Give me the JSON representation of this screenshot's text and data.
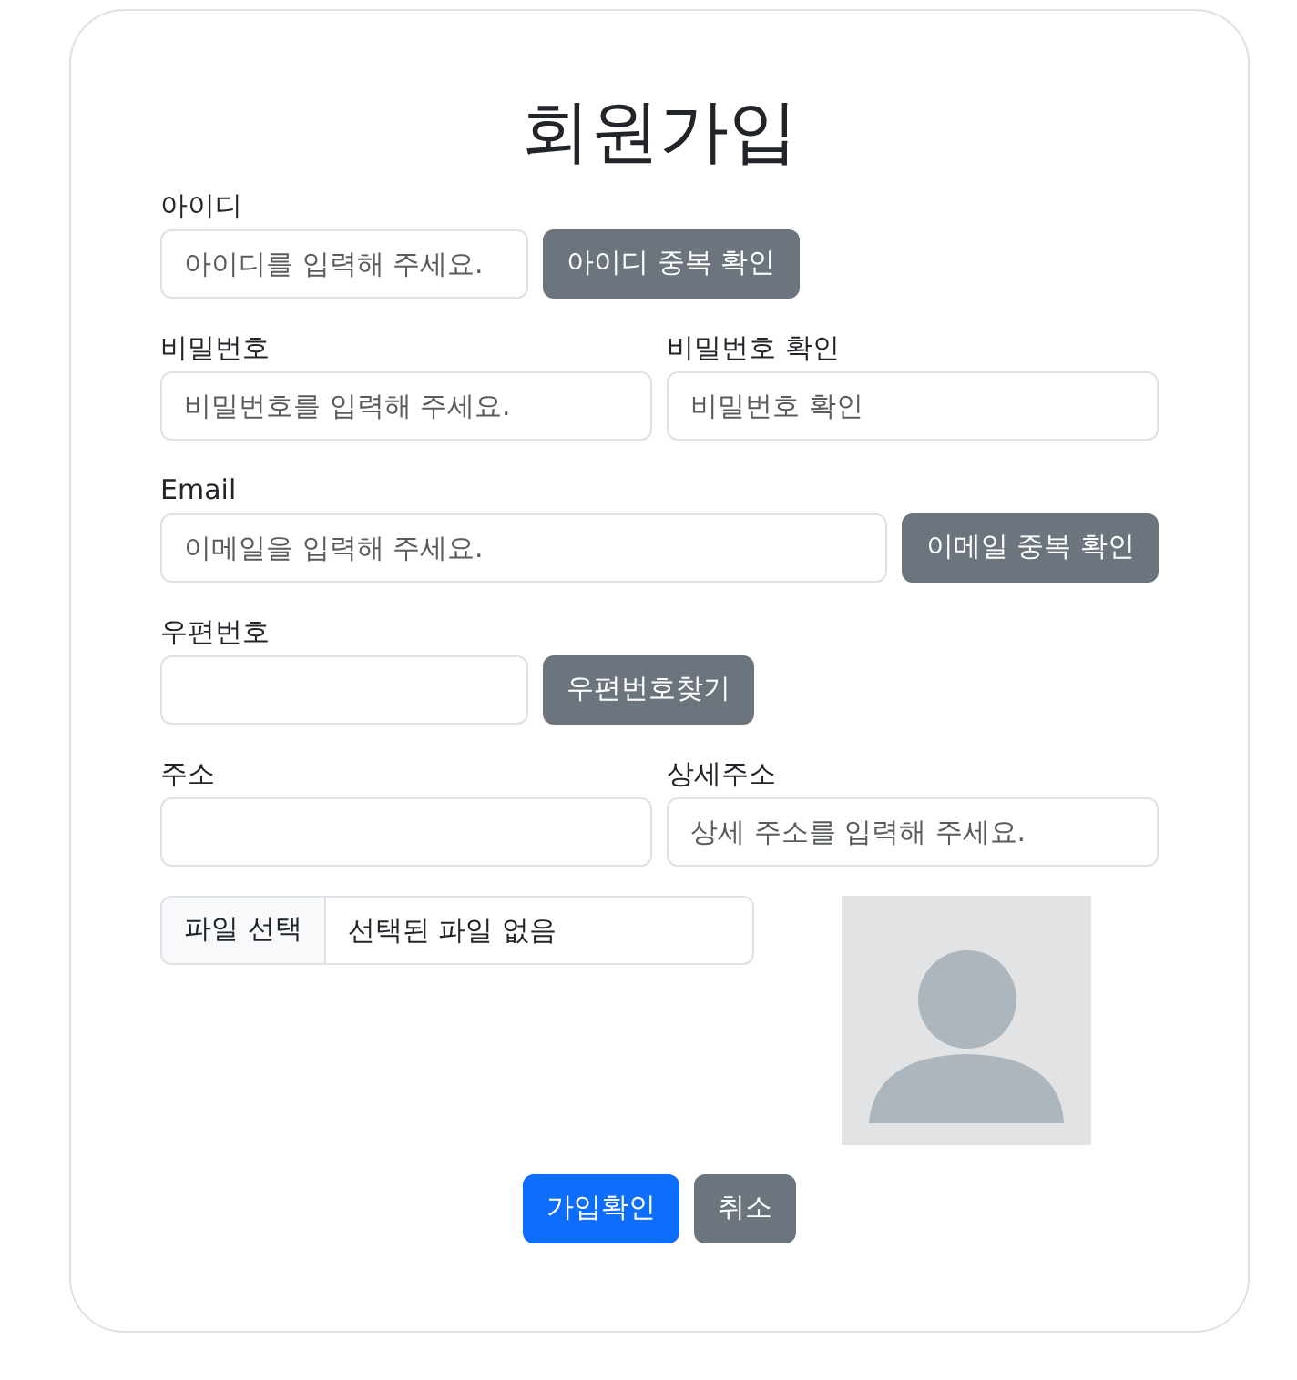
{
  "title": "회원가입",
  "rows": [
    {
      "kind": "short",
      "label": "아이디",
      "placeholder": "아이디를 입력해 주세요.",
      "button": "아이디 중복 확인"
    },
    {
      "kind": "pair",
      "fields": [
        {
          "label": "비밀번호",
          "placeholder": "비밀번호를 입력해 주세요."
        },
        {
          "label": "비밀번호 확인",
          "placeholder": "비밀번호 확인"
        }
      ]
    },
    {
      "kind": "wide",
      "label": "Email",
      "placeholder": "이메일을 입력해 주세요.",
      "button": "이메일 중복 확인"
    },
    {
      "kind": "short",
      "label": "우편번호",
      "button": "우편번호찾기"
    },
    {
      "kind": "pair",
      "fields": [
        {
          "label": "주소"
        },
        {
          "label": "상세주소",
          "placeholder": "상세 주소를 입력해 주세요."
        }
      ]
    }
  ],
  "file": {
    "button": "파일 선택",
    "status": "선택된 파일 없음"
  },
  "actions": [
    {
      "label": "가입확인",
      "kind": "primary"
    },
    {
      "label": "취소",
      "kind": "secondary"
    }
  ]
}
